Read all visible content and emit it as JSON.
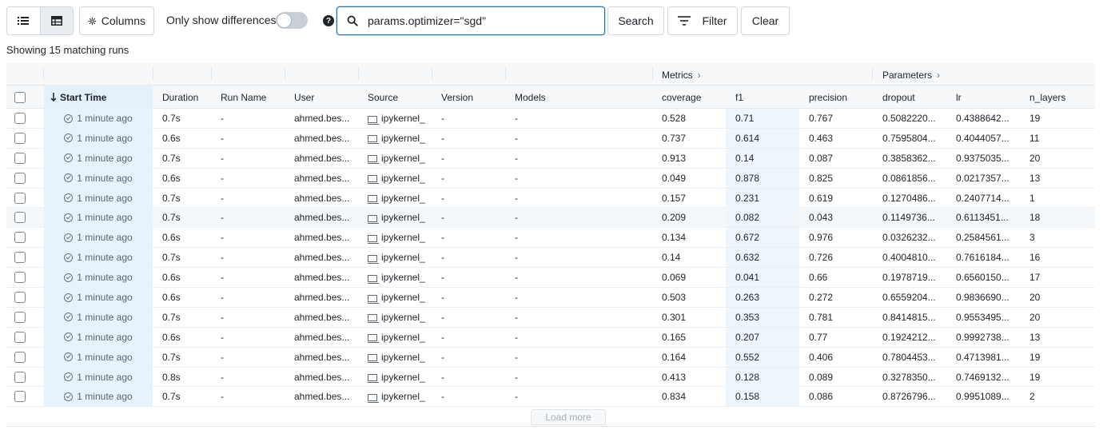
{
  "toolbar": {
    "columns_label": "Columns",
    "diff_label": "Only show differences",
    "search_value": "params.optimizer=\"sgd\"",
    "search_label": "Search",
    "filter_label": "Filter",
    "clear_label": "Clear",
    "diff_toggle_on": false
  },
  "summary": "Showing 15 matching runs",
  "groups": {
    "metrics": "Metrics",
    "parameters": "Parameters"
  },
  "columns": {
    "start_time": "Start Time",
    "duration": "Duration",
    "run_name": "Run Name",
    "user": "User",
    "source": "Source",
    "version": "Version",
    "models": "Models",
    "coverage": "coverage",
    "f1": "f1",
    "precision": "precision",
    "dropout": "dropout",
    "lr": "lr",
    "n_layers": "n_layers"
  },
  "rows": [
    {
      "start_time": "1 minute ago",
      "duration": "0.7s",
      "run_name": "-",
      "user": "ahmed.bes...",
      "source": "ipykernel_",
      "version": "-",
      "models": "-",
      "coverage": "0.528",
      "f1": "0.71",
      "precision": "0.767",
      "dropout": "0.5082220...",
      "lr": "0.4388642...",
      "n_layers": "19"
    },
    {
      "start_time": "1 minute ago",
      "duration": "0.6s",
      "run_name": "-",
      "user": "ahmed.bes...",
      "source": "ipykernel_",
      "version": "-",
      "models": "-",
      "coverage": "0.737",
      "f1": "0.614",
      "precision": "0.463",
      "dropout": "0.7595804...",
      "lr": "0.4044057...",
      "n_layers": "11"
    },
    {
      "start_time": "1 minute ago",
      "duration": "0.7s",
      "run_name": "-",
      "user": "ahmed.bes...",
      "source": "ipykernel_",
      "version": "-",
      "models": "-",
      "coverage": "0.913",
      "f1": "0.14",
      "precision": "0.087",
      "dropout": "0.3858362...",
      "lr": "0.9375035...",
      "n_layers": "20"
    },
    {
      "start_time": "1 minute ago",
      "duration": "0.6s",
      "run_name": "-",
      "user": "ahmed.bes...",
      "source": "ipykernel_",
      "version": "-",
      "models": "-",
      "coverage": "0.049",
      "f1": "0.878",
      "precision": "0.825",
      "dropout": "0.0861856...",
      "lr": "0.0217357...",
      "n_layers": "13"
    },
    {
      "start_time": "1 minute ago",
      "duration": "0.7s",
      "run_name": "-",
      "user": "ahmed.bes...",
      "source": "ipykernel_",
      "version": "-",
      "models": "-",
      "coverage": "0.157",
      "f1": "0.231",
      "precision": "0.619",
      "dropout": "0.1270486...",
      "lr": "0.2407714...",
      "n_layers": "1"
    },
    {
      "start_time": "1 minute ago",
      "duration": "0.7s",
      "run_name": "-",
      "user": "ahmed.bes...",
      "source": "ipykernel_",
      "version": "-",
      "models": "-",
      "coverage": "0.209",
      "f1": "0.082",
      "precision": "0.043",
      "dropout": "0.1149736...",
      "lr": "0.6113451...",
      "n_layers": "18"
    },
    {
      "start_time": "1 minute ago",
      "duration": "0.6s",
      "run_name": "-",
      "user": "ahmed.bes...",
      "source": "ipykernel_",
      "version": "-",
      "models": "-",
      "coverage": "0.134",
      "f1": "0.672",
      "precision": "0.976",
      "dropout": "0.0326232...",
      "lr": "0.2584561...",
      "n_layers": "3"
    },
    {
      "start_time": "1 minute ago",
      "duration": "0.7s",
      "run_name": "-",
      "user": "ahmed.bes...",
      "source": "ipykernel_",
      "version": "-",
      "models": "-",
      "coverage": "0.14",
      "f1": "0.632",
      "precision": "0.726",
      "dropout": "0.4004810...",
      "lr": "0.7616184...",
      "n_layers": "16"
    },
    {
      "start_time": "1 minute ago",
      "duration": "0.6s",
      "run_name": "-",
      "user": "ahmed.bes...",
      "source": "ipykernel_",
      "version": "-",
      "models": "-",
      "coverage": "0.069",
      "f1": "0.041",
      "precision": "0.66",
      "dropout": "0.1978719...",
      "lr": "0.6560150...",
      "n_layers": "17"
    },
    {
      "start_time": "1 minute ago",
      "duration": "0.6s",
      "run_name": "-",
      "user": "ahmed.bes...",
      "source": "ipykernel_",
      "version": "-",
      "models": "-",
      "coverage": "0.503",
      "f1": "0.263",
      "precision": "0.272",
      "dropout": "0.6559204...",
      "lr": "0.9836690...",
      "n_layers": "20"
    },
    {
      "start_time": "1 minute ago",
      "duration": "0.7s",
      "run_name": "-",
      "user": "ahmed.bes...",
      "source": "ipykernel_",
      "version": "-",
      "models": "-",
      "coverage": "0.301",
      "f1": "0.353",
      "precision": "0.781",
      "dropout": "0.8414815...",
      "lr": "0.9553495...",
      "n_layers": "20"
    },
    {
      "start_time": "1 minute ago",
      "duration": "0.6s",
      "run_name": "-",
      "user": "ahmed.bes...",
      "source": "ipykernel_",
      "version": "-",
      "models": "-",
      "coverage": "0.165",
      "f1": "0.207",
      "precision": "0.77",
      "dropout": "0.1924212...",
      "lr": "0.9992738...",
      "n_layers": "13"
    },
    {
      "start_time": "1 minute ago",
      "duration": "0.7s",
      "run_name": "-",
      "user": "ahmed.bes...",
      "source": "ipykernel_",
      "version": "-",
      "models": "-",
      "coverage": "0.164",
      "f1": "0.552",
      "precision": "0.406",
      "dropout": "0.7804453...",
      "lr": "0.4713981...",
      "n_layers": "19"
    },
    {
      "start_time": "1 minute ago",
      "duration": "0.8s",
      "run_name": "-",
      "user": "ahmed.bes...",
      "source": "ipykernel_",
      "version": "-",
      "models": "-",
      "coverage": "0.413",
      "f1": "0.128",
      "precision": "0.089",
      "dropout": "0.3278350...",
      "lr": "0.7469132...",
      "n_layers": "19"
    },
    {
      "start_time": "1 minute ago",
      "duration": "0.7s",
      "run_name": "-",
      "user": "ahmed.bes...",
      "source": "ipykernel_",
      "version": "-",
      "models": "-",
      "coverage": "0.834",
      "f1": "0.158",
      "precision": "0.086",
      "dropout": "0.8726796...",
      "lr": "0.9951089...",
      "n_layers": "2"
    }
  ],
  "highlighted_row": 5,
  "load_more_label": "Load more",
  "colors": {
    "accent": "#2272b4",
    "sorted_column": "#e6f3fc"
  }
}
